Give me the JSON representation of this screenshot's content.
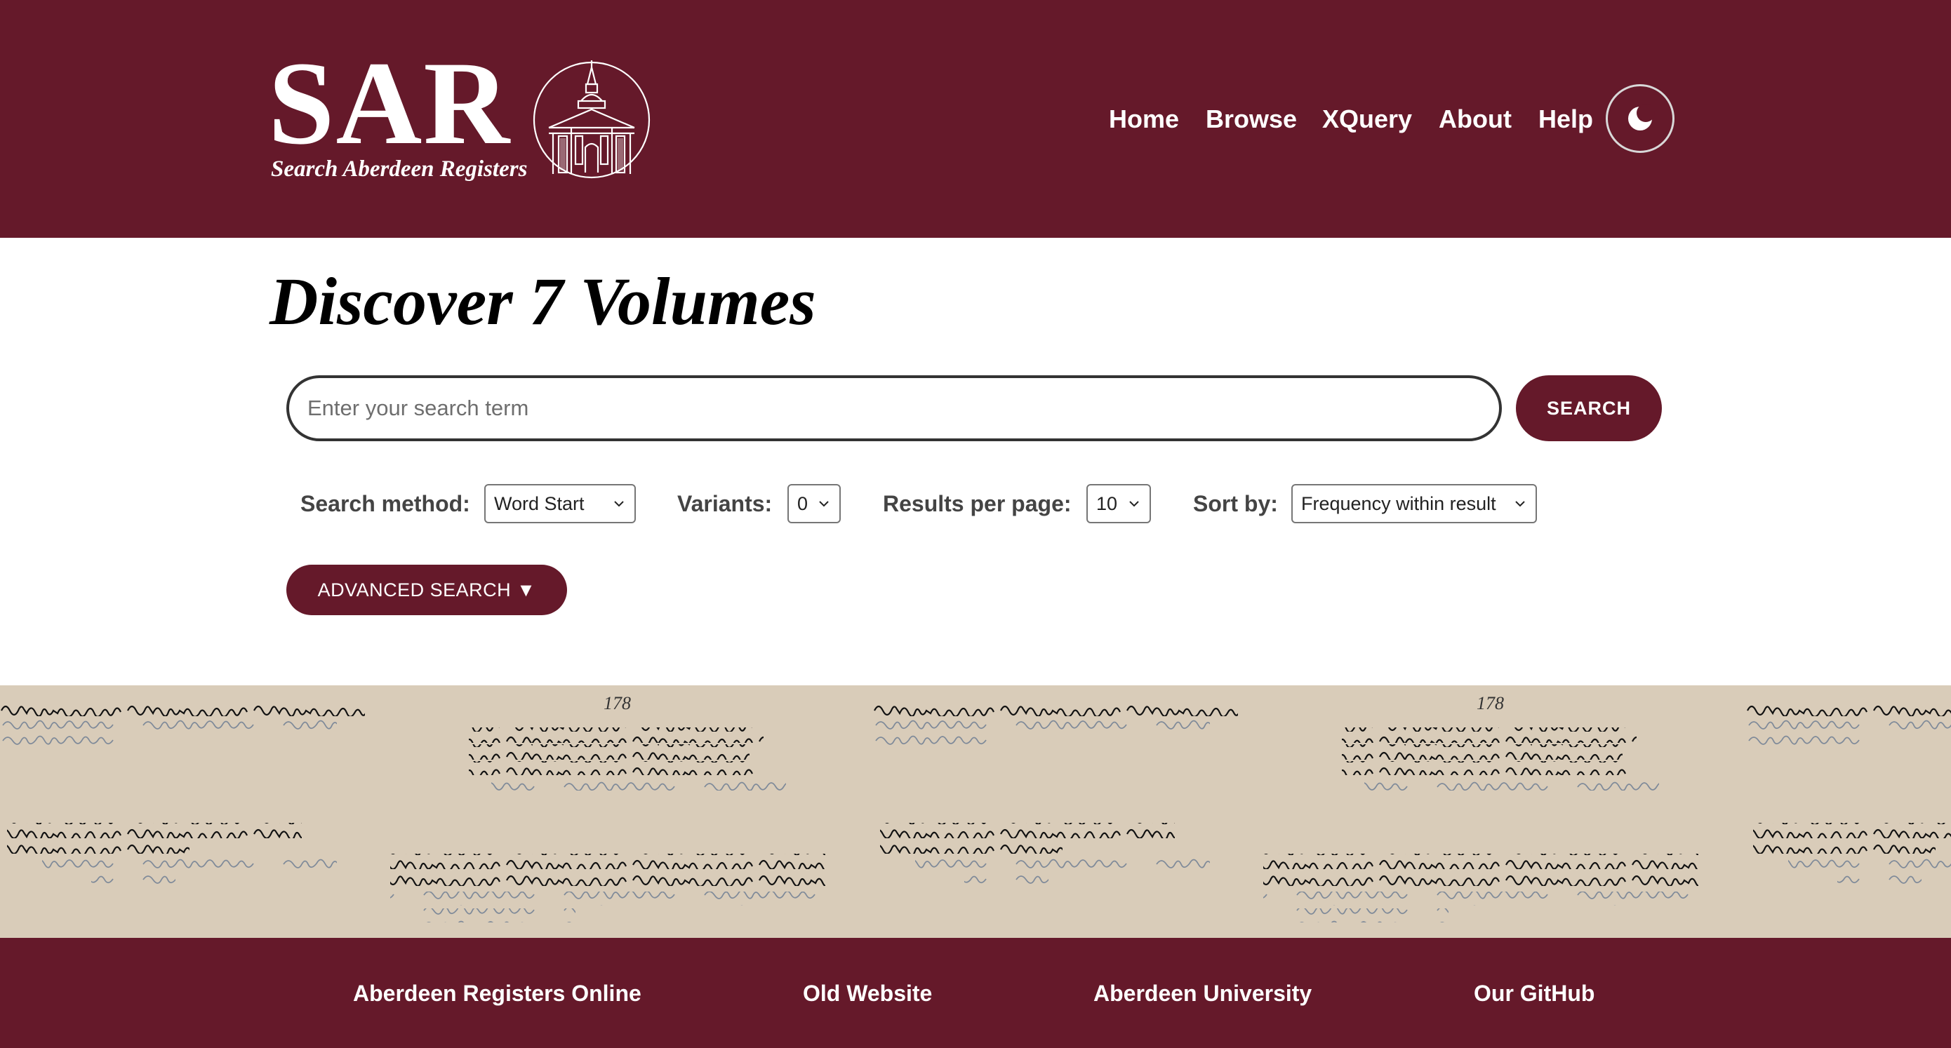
{
  "header": {
    "logo_text": "SAR",
    "logo_subtitle": "Search Aberdeen Registers",
    "nav": [
      "Home",
      "Browse",
      "XQuery",
      "About",
      "Help"
    ],
    "theme_toggle_icon": "moon-icon",
    "background_color": "#65192a"
  },
  "main": {
    "title": "Discover 7 Volumes",
    "search": {
      "placeholder": "Enter your search term",
      "value": "",
      "button_label": "SEARCH"
    },
    "options": {
      "method_label": "Search method:",
      "method_value": "Word Start",
      "variants_label": "Variants:",
      "variants_value": "0",
      "per_page_label": "Results per page:",
      "per_page_value": "10",
      "sort_label": "Sort by:",
      "sort_value": "Frequency within result"
    },
    "advanced_label": "ADVANCED SEARCH ▼"
  },
  "banner": {
    "folio_number": "178",
    "background_color": "#d9ccb9"
  },
  "footer": {
    "links": [
      "Aberdeen Registers Online",
      "Old Website",
      "Aberdeen University",
      "Our GitHub"
    ]
  }
}
